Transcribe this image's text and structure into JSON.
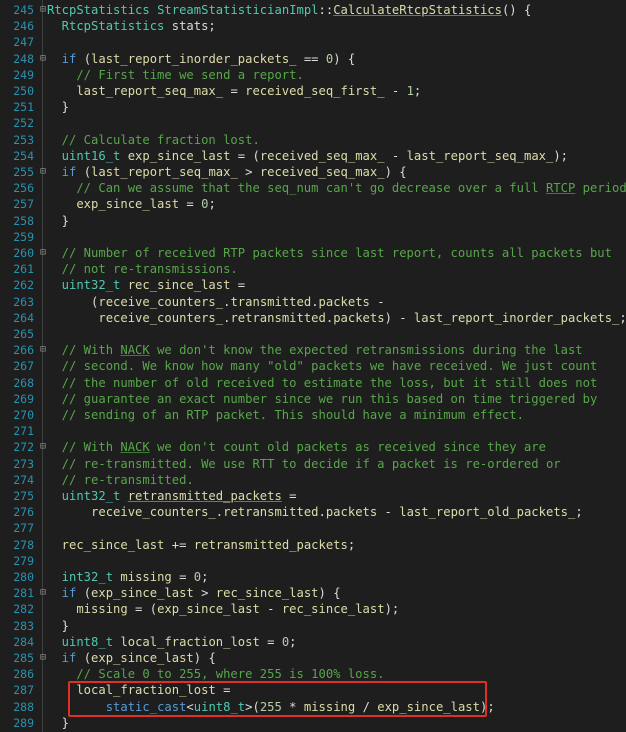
{
  "editor": {
    "language": "cpp",
    "lines": [
      {
        "n": "245",
        "fold": "⊟",
        "segs": [
          [
            "RtcpStatistics",
            "t-ty"
          ],
          [
            " ",
            "t-tx"
          ],
          [
            "StreamStatisticianImpl",
            "t-ty"
          ],
          [
            "::",
            "t-tx"
          ],
          [
            "CalculateRtcpStatistics",
            "t-fn"
          ],
          [
            "() {",
            "t-tx"
          ]
        ]
      },
      {
        "n": "246",
        "fold": "",
        "segs": [
          [
            "  RtcpStatistics",
            "t-ty"
          ],
          [
            " stats;",
            "t-tx"
          ]
        ]
      },
      {
        "n": "247",
        "fold": "",
        "segs": []
      },
      {
        "n": "248",
        "fold": "⊟",
        "segs": [
          [
            "  if",
            "t-kw"
          ],
          [
            " (",
            "t-tx"
          ],
          [
            "last_report_inorder_packets_",
            "t-id"
          ],
          [
            " == ",
            "t-tx"
          ],
          [
            "0",
            "t-num"
          ],
          [
            ") {",
            "t-tx"
          ]
        ]
      },
      {
        "n": "249",
        "fold": "",
        "segs": [
          [
            "    // First time we send a report.",
            "t-cm"
          ]
        ]
      },
      {
        "n": "250",
        "fold": "",
        "segs": [
          [
            "    last_report_seq_max_",
            "t-id"
          ],
          [
            " = ",
            "t-tx"
          ],
          [
            "received_seq_first_",
            "t-id"
          ],
          [
            " - ",
            "t-tx"
          ],
          [
            "1",
            "t-num"
          ],
          [
            ";",
            "t-tx"
          ]
        ]
      },
      {
        "n": "251",
        "fold": "",
        "segs": [
          [
            "  }",
            "t-tx"
          ]
        ]
      },
      {
        "n": "252",
        "fold": "",
        "segs": []
      },
      {
        "n": "253",
        "fold": "",
        "segs": [
          [
            "  // Calculate fraction lost.",
            "t-cm"
          ]
        ]
      },
      {
        "n": "254",
        "fold": "",
        "segs": [
          [
            "  uint16_t",
            "t-ty"
          ],
          [
            " ",
            "t-tx"
          ],
          [
            "exp_since_last",
            "t-id"
          ],
          [
            " = (",
            "t-tx"
          ],
          [
            "received_seq_max_",
            "t-id"
          ],
          [
            " - ",
            "t-tx"
          ],
          [
            "last_report_seq_max_",
            "t-id"
          ],
          [
            ");",
            "t-tx"
          ]
        ]
      },
      {
        "n": "255",
        "fold": "⊟",
        "segs": [
          [
            "  if",
            "t-kw"
          ],
          [
            " (",
            "t-tx"
          ],
          [
            "last_report_seq_max_",
            "t-id"
          ],
          [
            " > ",
            "t-tx"
          ],
          [
            "received_seq_max_",
            "t-id"
          ],
          [
            ") {",
            "t-tx"
          ]
        ]
      },
      {
        "n": "256",
        "fold": "",
        "segs": [
          [
            "    // Can we assume that the seq_num can't go decrease over a full ",
            "t-cm"
          ],
          [
            "RTCP",
            "t-cm-u"
          ],
          [
            " period?",
            "t-cm"
          ]
        ]
      },
      {
        "n": "257",
        "fold": "",
        "segs": [
          [
            "    exp_since_last",
            "t-id"
          ],
          [
            " = ",
            "t-tx"
          ],
          [
            "0",
            "t-num"
          ],
          [
            ";",
            "t-tx"
          ]
        ]
      },
      {
        "n": "258",
        "fold": "",
        "segs": [
          [
            "  }",
            "t-tx"
          ]
        ]
      },
      {
        "n": "259",
        "fold": "",
        "segs": []
      },
      {
        "n": "260",
        "fold": "⊟",
        "segs": [
          [
            "  // Number of received RTP packets since last report, counts all packets but",
            "t-cm"
          ]
        ]
      },
      {
        "n": "261",
        "fold": "",
        "segs": [
          [
            "  // not re-transmissions.",
            "t-cm"
          ]
        ]
      },
      {
        "n": "262",
        "fold": "",
        "segs": [
          [
            "  uint32_t",
            "t-ty"
          ],
          [
            " ",
            "t-tx"
          ],
          [
            "rec_since_last",
            "t-id"
          ],
          [
            " =",
            "t-tx"
          ]
        ]
      },
      {
        "n": "263",
        "fold": "",
        "segs": [
          [
            "      (",
            "t-tx"
          ],
          [
            "receive_counters_",
            "t-id"
          ],
          [
            ".",
            "t-tx"
          ],
          [
            "transmitted",
            "t-id"
          ],
          [
            ".",
            "t-tx"
          ],
          [
            "packets",
            "t-id"
          ],
          [
            " -",
            "t-tx"
          ]
        ]
      },
      {
        "n": "264",
        "fold": "",
        "segs": [
          [
            "       receive_counters_",
            "t-id"
          ],
          [
            ".",
            "t-tx"
          ],
          [
            "retransmitted",
            "t-id"
          ],
          [
            ".",
            "t-tx"
          ],
          [
            "packets",
            "t-id"
          ],
          [
            ") - ",
            "t-tx"
          ],
          [
            "last_report_inorder_packets_",
            "t-id"
          ],
          [
            ";",
            "t-tx"
          ]
        ]
      },
      {
        "n": "265",
        "fold": "",
        "segs": [
          [
            "  ",
            "t-tx"
          ]
        ]
      },
      {
        "n": "266",
        "fold": "⊟",
        "segs": [
          [
            "  // With ",
            "t-cm"
          ],
          [
            "NACK",
            "t-cm-u"
          ],
          [
            " we don't know the expected retransmissions during the last",
            "t-cm"
          ]
        ]
      },
      {
        "n": "267",
        "fold": "",
        "segs": [
          [
            "  // second. We know how many \"old\" packets we have received. We just count",
            "t-cm"
          ]
        ]
      },
      {
        "n": "268",
        "fold": "",
        "segs": [
          [
            "  // the number of old received to estimate the loss, but it still does not",
            "t-cm"
          ]
        ]
      },
      {
        "n": "269",
        "fold": "",
        "segs": [
          [
            "  // guarantee an exact number since we run this based on time triggered by",
            "t-cm"
          ]
        ]
      },
      {
        "n": "270",
        "fold": "",
        "segs": [
          [
            "  // sending of an RTP packet. This should have a minimum effect.",
            "t-cm"
          ]
        ]
      },
      {
        "n": "271",
        "fold": "",
        "segs": []
      },
      {
        "n": "272",
        "fold": "⊟",
        "segs": [
          [
            "  // With ",
            "t-cm"
          ],
          [
            "NACK",
            "t-cm-u"
          ],
          [
            " we don't count old packets as received since they are",
            "t-cm"
          ]
        ]
      },
      {
        "n": "273",
        "fold": "",
        "segs": [
          [
            "  // re-transmitted. We use RTT to decide if a packet is re-ordered or",
            "t-cm"
          ]
        ]
      },
      {
        "n": "274",
        "fold": "",
        "segs": [
          [
            "  // re-transmitted.",
            "t-cm"
          ]
        ]
      },
      {
        "n": "275",
        "fold": "",
        "segs": [
          [
            "  uint32_t",
            "t-ty"
          ],
          [
            " ",
            "t-tx"
          ],
          [
            "retransmitted_packets",
            "t-id-u"
          ],
          [
            " =",
            "t-tx"
          ]
        ]
      },
      {
        "n": "276",
        "fold": "",
        "segs": [
          [
            "      receive_counters_",
            "t-id"
          ],
          [
            ".",
            "t-tx"
          ],
          [
            "retransmitted",
            "t-id"
          ],
          [
            ".",
            "t-tx"
          ],
          [
            "packets",
            "t-id"
          ],
          [
            " - ",
            "t-tx"
          ],
          [
            "last_report_old_packets_",
            "t-id"
          ],
          [
            ";",
            "t-tx"
          ]
        ]
      },
      {
        "n": "277",
        "fold": "",
        "segs": [
          [
            "  ",
            "t-tx"
          ]
        ]
      },
      {
        "n": "278",
        "fold": "",
        "segs": [
          [
            "  rec_since_last",
            "t-id"
          ],
          [
            " += ",
            "t-tx"
          ],
          [
            "retransmitted_packets",
            "t-id"
          ],
          [
            ";",
            "t-tx"
          ]
        ]
      },
      {
        "n": "279",
        "fold": "",
        "segs": []
      },
      {
        "n": "280",
        "fold": "",
        "segs": [
          [
            "  int32_t",
            "t-ty"
          ],
          [
            " ",
            "t-tx"
          ],
          [
            "missing",
            "t-id"
          ],
          [
            " = ",
            "t-tx"
          ],
          [
            "0",
            "t-num"
          ],
          [
            ";",
            "t-tx"
          ]
        ]
      },
      {
        "n": "281",
        "fold": "⊟",
        "segs": [
          [
            "  if",
            "t-kw"
          ],
          [
            " (",
            "t-tx"
          ],
          [
            "exp_since_last",
            "t-id"
          ],
          [
            " > ",
            "t-tx"
          ],
          [
            "rec_since_last",
            "t-id"
          ],
          [
            ") {",
            "t-tx"
          ]
        ]
      },
      {
        "n": "282",
        "fold": "",
        "segs": [
          [
            "    missing",
            "t-id"
          ],
          [
            " = (",
            "t-tx"
          ],
          [
            "exp_since_last",
            "t-id"
          ],
          [
            " - ",
            "t-tx"
          ],
          [
            "rec_since_last",
            "t-id"
          ],
          [
            ");",
            "t-tx"
          ]
        ]
      },
      {
        "n": "283",
        "fold": "",
        "segs": [
          [
            "  }",
            "t-tx"
          ]
        ]
      },
      {
        "n": "284",
        "fold": "",
        "segs": [
          [
            "  uint8_t",
            "t-ty"
          ],
          [
            " ",
            "t-tx"
          ],
          [
            "local_fraction_lost",
            "t-id"
          ],
          [
            " = ",
            "t-tx"
          ],
          [
            "0",
            "t-num"
          ],
          [
            ";",
            "t-tx"
          ]
        ]
      },
      {
        "n": "285",
        "fold": "⊟",
        "segs": [
          [
            "  if",
            "t-kw"
          ],
          [
            " (",
            "t-tx"
          ],
          [
            "exp_since_last",
            "t-id"
          ],
          [
            ") {",
            "t-tx"
          ]
        ]
      },
      {
        "n": "286",
        "fold": "",
        "segs": [
          [
            "    // Scale 0 to 255, where 255 is 100% loss.",
            "t-cm"
          ]
        ]
      },
      {
        "n": "287",
        "fold": "",
        "segs": [
          [
            "    local_fraction_lost",
            "t-id"
          ],
          [
            " =",
            "t-tx"
          ]
        ]
      },
      {
        "n": "288",
        "fold": "",
        "segs": [
          [
            "        ",
            "t-tx"
          ],
          [
            "static_cast",
            "t-kw"
          ],
          [
            "<",
            "t-tx"
          ],
          [
            "uint8_t",
            "t-ty"
          ],
          [
            ">(",
            "t-tx"
          ],
          [
            "255",
            "t-num"
          ],
          [
            " * ",
            "t-tx"
          ],
          [
            "missing",
            "t-id"
          ],
          [
            " / ",
            "t-tx"
          ],
          [
            "exp_since_last",
            "t-id"
          ],
          [
            ");",
            "t-tx"
          ]
        ]
      },
      {
        "n": "289",
        "fold": "",
        "segs": [
          [
            "  }",
            "t-tx"
          ]
        ]
      }
    ]
  },
  "annotation": {
    "color": "#e03025",
    "lines_highlighted": [
      "287",
      "288"
    ]
  },
  "colors": {
    "background": "#1e1e1e",
    "line_number": "#2b91af",
    "keyword": "#569cd6",
    "type": "#4ec9b0",
    "identifier": "#dcdcaa",
    "comment": "#57a64a",
    "number": "#b5cea8"
  }
}
